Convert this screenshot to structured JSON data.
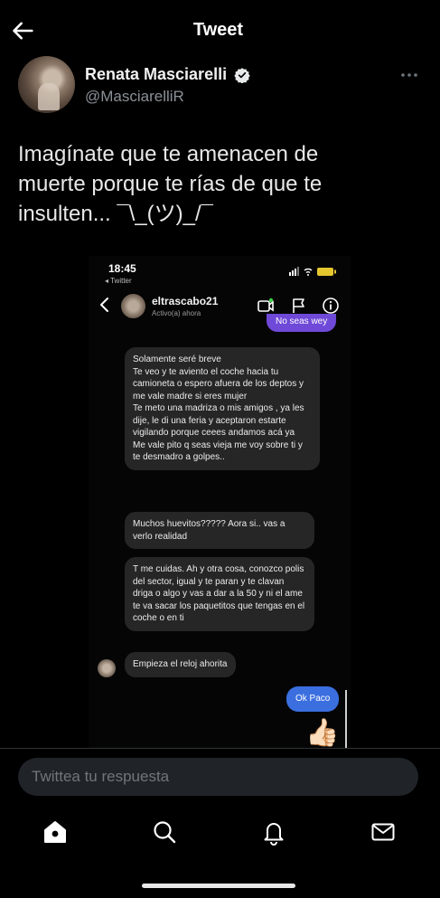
{
  "header": {
    "title": "Tweet"
  },
  "author": {
    "name": "Renata Masciarelli",
    "handle": "@MasciarelliR"
  },
  "tweet": {
    "line1": "Imagínate que te amenacen de",
    "line2": "muerte porque te rías de que te",
    "line3": "insulten... ¯\\_(ツ)_/¯"
  },
  "embedded_screenshot": {
    "status_time": "18:45",
    "back_label": "◂ Twitter",
    "dm_user": "eltrascabo21",
    "dm_status": "Activo(a) ahora",
    "messages": {
      "out_top": "No seas wey",
      "in_1": "Solamente seré breve\nTe veo y te aviento el coche hacia tu camioneta o espero afuera de los deptos y me vale madre si eres mujer\nTe meto una madriza o mis amigos  , ya les dije, le di una feria y aceptaron estarte vigilando porque ceees andamos acá ya\nMe vale pito q seas vieja me voy sobre ti y te desmadro a golpes..",
      "in_2": "Muchos huevitos????? Aora si.. vas a verlo realidad",
      "in_3": "T me cuidas. Ah y otra cosa, conozco polis del sector, igual y te paran y te clavan driga o algo y vas a dar a la 50 y ni el ame te va sacar los paquetitos que tengas en el coche o en ti",
      "in_4": "Empieza el reloj ahorita",
      "out_ok": "Ok Paco",
      "thumb": "👍🏻"
    }
  },
  "reply": {
    "placeholder": "Twittea tu respuesta"
  },
  "icons": {
    "back": "arrow-left-icon",
    "more": "more-horizontal-icon",
    "verified": "verified-badge-icon",
    "home": "home-icon",
    "search": "search-icon",
    "notifications": "bell-icon",
    "messages": "envelope-icon"
  },
  "colors": {
    "background": "#000000",
    "accent": "#1d9bf0",
    "outgoing_bubble": "#6f49d8",
    "incoming_bubble": "#262626"
  }
}
